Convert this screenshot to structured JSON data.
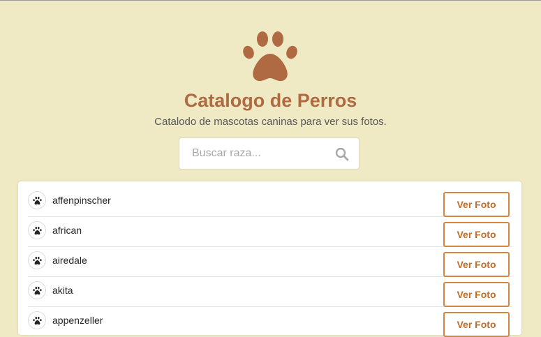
{
  "header": {
    "logo_icon": "paw-icon",
    "title": "Catalogo de Perros",
    "subtitle": "Catalodo de mascotas caninas para ver sus fotos."
  },
  "search": {
    "placeholder": "Buscar raza...",
    "value": "",
    "icon": "search-icon"
  },
  "breeds": [
    {
      "name": "affenpinscher",
      "button_label": "Ver Foto"
    },
    {
      "name": "african",
      "button_label": "Ver Foto"
    },
    {
      "name": "airedale",
      "button_label": "Ver Foto"
    },
    {
      "name": "akita",
      "button_label": "Ver Foto"
    },
    {
      "name": "appenzeller",
      "button_label": "Ver Foto"
    }
  ],
  "colors": {
    "background": "#f0eac4",
    "accent": "#b06a42",
    "button_border": "#d48640"
  }
}
